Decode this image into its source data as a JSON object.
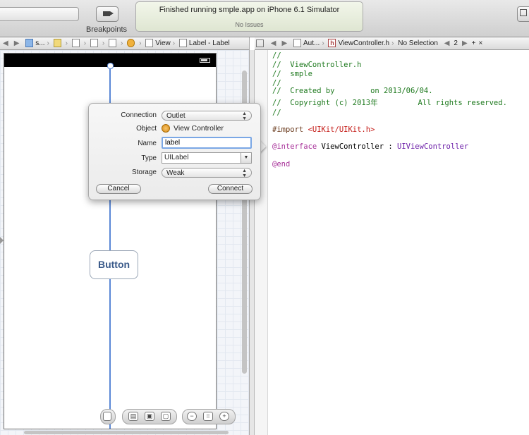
{
  "toolbar": {
    "breakpoints_label": "Breakpoints",
    "activity_title": "Finished running smple.app on iPhone 6.1 Simulator",
    "activity_status": "No Issues"
  },
  "left_jumpbar": {
    "nav_back": "◀",
    "nav_forward": "▶",
    "items": [
      "s...",
      "",
      "",
      "",
      "",
      "",
      "View",
      "Label - Label"
    ]
  },
  "right_jumpbar": {
    "related": "",
    "back": "◀",
    "forward": "▶",
    "mode": "Aut...",
    "file": "ViewController.h",
    "selection": "No Selection",
    "counter": "2",
    "add_label": "+",
    "close_label": "×"
  },
  "canvas": {
    "button_label": "Button"
  },
  "popover": {
    "connection_label": "Connection",
    "connection_value": "Outlet",
    "object_label": "Object",
    "object_value": "View Controller",
    "name_label": "Name",
    "name_value": "label",
    "type_label": "Type",
    "type_value": "UILabel",
    "storage_label": "Storage",
    "storage_value": "Weak",
    "cancel": "Cancel",
    "connect": "Connect"
  },
  "code": {
    "l1": "//",
    "l2": "//  ViewController.h",
    "l3": "//  smple",
    "l4": "//",
    "l5": "//  Created by        on 2013/06/04.",
    "l6": "//  Copyright (c) 2013年         All rights reserved.",
    "l7": "//",
    "import_kw": "#import ",
    "import_str": "<UIKit/UIKit.h>",
    "iface_kw": "@interface",
    "iface_name": " ViewController : ",
    "iface_super": "UIViewController",
    "end_kw": "@end"
  },
  "icons": {
    "list": [
      "breakpoints-icon",
      "file-icon",
      "folder-icon",
      "object-icon",
      "view-icon",
      "header-file-icon",
      "zoom-out-icon",
      "zoom-in-icon",
      "battery-icon"
    ]
  },
  "colors": {
    "comment": "#1f7a1f",
    "keyword": "#a8329a",
    "string": "#c41a16",
    "guide": "#5a88d6"
  }
}
